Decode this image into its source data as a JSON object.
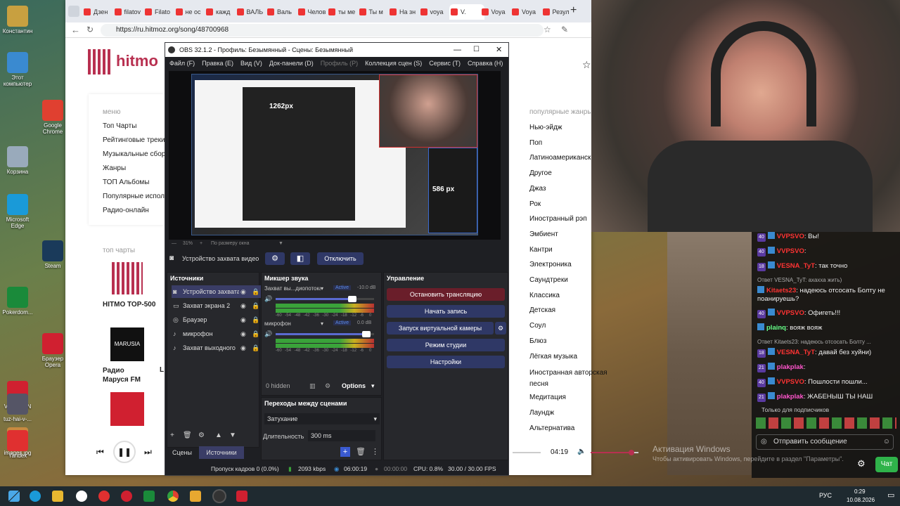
{
  "desktop": {
    "icons": [
      {
        "label": "Константин",
        "color": "#c8a040"
      },
      {
        "label": "Этот компьютер",
        "color": "#3a8ad0"
      },
      {
        "label": "Google Chrome",
        "color": "#e04030"
      },
      {
        "label": "Корзина",
        "color": "#9ab"
      },
      {
        "label": "Microsoft Edge",
        "color": "#1a9ad8"
      },
      {
        "label": "Steam",
        "color": "#1a3a5a"
      },
      {
        "label": "Pokerdom...",
        "color": "#1a8a3a"
      },
      {
        "label": "Браузер Opera",
        "color": "#d02030"
      },
      {
        "label": "VanyaVPN",
        "color": "#d02030"
      },
      {
        "label": "images.jpg",
        "color": "#c88a40"
      },
      {
        "label": "tuz-hai-v-...",
        "color": "#556"
      },
      {
        "label": "Yandex",
        "color": "#e03030"
      }
    ],
    "watermark_line1": "Активация Windows",
    "watermark_line2": "Чтобы активировать Windows, перейдите в раздел \"Параметры\"."
  },
  "browser": {
    "tabs": [
      "Дзен",
      "filatov",
      "Filato",
      "не ос",
      "кажд",
      "ВАЛЬ",
      "Валь",
      "Челов",
      "ты ме",
      "Ты м",
      "На зн",
      "voya",
      "V.",
      "Voya",
      "Voya",
      "Резул"
    ],
    "url": "https://ru.hitmoz.org/song/48700968",
    "logo": "hitmo",
    "menu_title": "меню",
    "menu_items": [
      "Топ Чарты",
      "Рейтинговые треки",
      "Музыкальные сборники",
      "Жанры",
      "ТОП Альбомы",
      "Популярные исполнители",
      "Радио-онлайн"
    ],
    "top_charts_title": "топ чарты",
    "chart_labels": [
      "HITMO TOP-500",
      "Радио Маруся FM",
      "L"
    ],
    "genres_title": "популярные жанры",
    "genres": [
      "Нью-эйдж",
      "Поп",
      "Латиноамериканская",
      "Другое",
      "Джаз",
      "Рок",
      "Иностранный рэп",
      "Эмбиент",
      "Кантри",
      "Электроника",
      "Саундтреки",
      "Классика",
      "Детская",
      "Соул",
      "Блюз",
      "Лёгкая музыка",
      "Иностранная авторская песня",
      "Медитация",
      "Лаундж",
      "Альтернатива"
    ],
    "player_time": "04:19",
    "volume_level": 0.85
  },
  "obs": {
    "title": "OBS 32.1.2 - Профиль: Безымянный - Сцены: Безымянный",
    "menu": [
      "Файл (F)",
      "Правка (E)",
      "Вид (V)",
      "Док-панели (D)",
      "Профиль (P)",
      "Коллекция сцен (S)",
      "Сервис (T)",
      "Справка (H)"
    ],
    "preview_label_1": "1262px",
    "preview_label_2": "586 px",
    "zoom": "31%",
    "zoom_mode": "По размеру окна",
    "device_name": "Устройство захвата видео",
    "disconnect": "Отключить",
    "sources_title": "Источники",
    "sources": [
      "Устройство захвата",
      "Захват экрана 2",
      "Браузер",
      "микрофон",
      "Захват выходного"
    ],
    "mixer_title": "Микшер звука",
    "mixer": [
      {
        "name": "Захват вы...диопотока",
        "status": "Active",
        "db": "-10.0 dB",
        "level": 0.78
      },
      {
        "name": "микрофон",
        "status": "Active",
        "db": "0.0 dB",
        "level": 0.92
      }
    ],
    "meter_ticks": [
      "-60",
      "-54",
      "-48",
      "-42",
      "-36",
      "-30",
      "-24",
      "-18",
      "-12",
      "-6",
      "0"
    ],
    "hidden": "0 hidden",
    "options": "Options",
    "control_title": "Управление",
    "controls": [
      "Остановить трансляцию",
      "Начать запись",
      "Запуск виртуальной камеры",
      "Режим студии",
      "Настройки"
    ],
    "transitions_title": "Переходы между сценами",
    "transition": "Затухание",
    "duration_label": "Длительность",
    "duration": "300 ms",
    "bottom_tabs": [
      "Сцены",
      "Источники"
    ],
    "status": {
      "dropped": "Пропуск кадров 0 (0.0%)",
      "kbps": "2093 kbps",
      "stream_time": "06:00:19",
      "rec_time": "00:00:00",
      "cpu": "CPU: 0.8%",
      "fps": "30.00 / 30.00 FPS"
    }
  },
  "chat": {
    "messages": [
      {
        "badge": "40",
        "name": "VVPSVO",
        "color": "#ff3333",
        "text": ": Вы!"
      },
      {
        "badge": "40",
        "name": "VVPSVO",
        "color": "#ff3333",
        "text": ":"
      },
      {
        "badge": "18",
        "name": "VESNA_TyT",
        "color": "#ff3333",
        "text": ": так точно"
      },
      {
        "badge": "",
        "name": "Ответ VESNA_TyT: ахахха",
        "color": "#aaa",
        "text": " жить)"
      },
      {
        "badge": "",
        "name": "Kitaets23",
        "color": "#ff3333",
        "text": ": надеюсь отсосать Болту не поанируешь?"
      },
      {
        "badge": "40",
        "name": "VVPSVO",
        "color": "#ff3333",
        "text": ": Офигеть!!!"
      },
      {
        "badge": "",
        "name": "plainq",
        "color": "#66ff88",
        "text": ": вояж вояж"
      },
      {
        "badge": "",
        "name": "Ответ Kitaets23: надеюсь отсосать Болту ...",
        "color": "#aaa",
        "text": ""
      },
      {
        "badge": "18",
        "name": "VESNA_TyT",
        "color": "#ff3333",
        "text": ": давай без хуйни)"
      },
      {
        "badge": "21",
        "name": "plakplak",
        "color": "#ff55cc",
        "text": ":"
      },
      {
        "badge": "40",
        "name": "VVPSVO",
        "color": "#ff3333",
        "text": ": Пошлости пошли..."
      },
      {
        "badge": "21",
        "name": "plakplak",
        "color": "#ff55cc",
        "text": ": ЖАБЕНЫШ ТЫ НАШ"
      }
    ],
    "subs_only": "Только для подписчиков",
    "input_placeholder": "Отправить сообщение",
    "send": "Чат"
  },
  "taskbar": {
    "lang": "РУС",
    "time": "0:29",
    "date": "10.08.2026"
  }
}
